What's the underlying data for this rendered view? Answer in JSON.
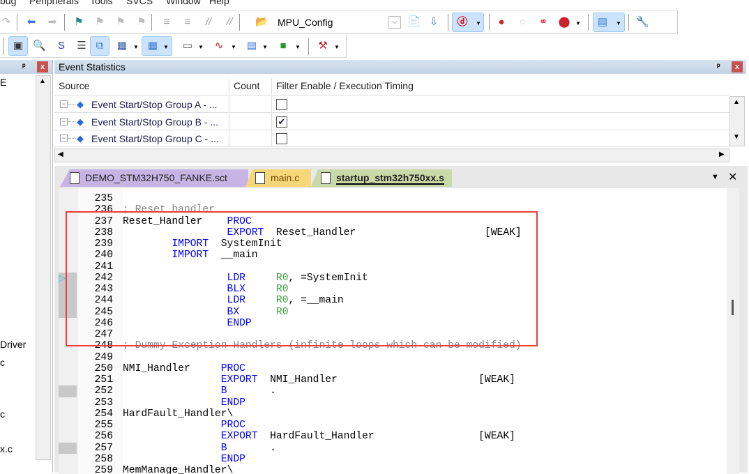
{
  "menu": [
    "bug",
    "Peripherals",
    "Tools",
    "SVCS",
    "Window",
    "Help"
  ],
  "toolbar": {
    "target_name": "MPU_Config"
  },
  "left_panel": {
    "items": [
      "E",
      "Driver",
      "c",
      "c",
      "x.c"
    ]
  },
  "event_statistics": {
    "title": "Event Statistics",
    "columns": [
      "Source",
      "Count",
      "Filter Enable / Execution Timing"
    ],
    "rows": [
      {
        "source": "Event Start/Stop Group A - ...",
        "count": "",
        "enabled": false
      },
      {
        "source": "Event Start/Stop Group B - ...",
        "count": "",
        "enabled": true
      },
      {
        "source": "Event Start/Stop Group C - ...",
        "count": "",
        "enabled": false
      }
    ]
  },
  "editor": {
    "tabs": [
      {
        "label": "DEMO_STM32H750_FANKE.sct",
        "color": "#c8b4e4",
        "active": false
      },
      {
        "label": "main.c",
        "color": "#f5d77a",
        "active": false
      },
      {
        "label": "startup_stm32h750xx.s",
        "color": "#c9d9a7",
        "active": true
      }
    ],
    "current_line": 242,
    "lines": [
      {
        "n": "235",
        "s": []
      },
      {
        "n": "236",
        "s": [
          [
            "; Reset handler",
            "c"
          ]
        ]
      },
      {
        "n": "237",
        "s": [
          [
            "Reset_Handler    ",
            "p"
          ],
          [
            "PROC",
            "k"
          ]
        ]
      },
      {
        "n": "238",
        "s": [
          [
            "                 ",
            "p"
          ],
          [
            "EXPORT",
            "k"
          ],
          [
            "  Reset_Handler                     [WEAK]",
            "p"
          ]
        ]
      },
      {
        "n": "239",
        "s": [
          [
            "        ",
            "p"
          ],
          [
            "IMPORT",
            "k"
          ],
          [
            "  SystemInit",
            "p"
          ]
        ]
      },
      {
        "n": "240",
        "s": [
          [
            "        ",
            "p"
          ],
          [
            "IMPORT",
            "k"
          ],
          [
            "  __main",
            "p"
          ]
        ]
      },
      {
        "n": "241",
        "s": []
      },
      {
        "n": "242",
        "s": [
          [
            "                 ",
            "p"
          ],
          [
            "LDR",
            "k"
          ],
          [
            "     ",
            "p"
          ],
          [
            "R0",
            "r"
          ],
          [
            ", =SystemInit",
            "p"
          ]
        ]
      },
      {
        "n": "243",
        "s": [
          [
            "                 ",
            "p"
          ],
          [
            "BLX",
            "k"
          ],
          [
            "     ",
            "p"
          ],
          [
            "R0",
            "r"
          ]
        ]
      },
      {
        "n": "244",
        "s": [
          [
            "                 ",
            "p"
          ],
          [
            "LDR",
            "k"
          ],
          [
            "     ",
            "p"
          ],
          [
            "R0",
            "r"
          ],
          [
            ", =__main",
            "p"
          ]
        ]
      },
      {
        "n": "245",
        "s": [
          [
            "                 ",
            "p"
          ],
          [
            "BX",
            "k"
          ],
          [
            "      ",
            "p"
          ],
          [
            "R0",
            "r"
          ]
        ]
      },
      {
        "n": "246",
        "s": [
          [
            "                 ",
            "p"
          ],
          [
            "ENDP",
            "k"
          ]
        ]
      },
      {
        "n": "247",
        "s": []
      },
      {
        "n": "248",
        "s": [
          [
            "; Dummy Exception Handlers (infinite loops which can be modified)",
            "c"
          ]
        ]
      },
      {
        "n": "249",
        "s": []
      },
      {
        "n": "250",
        "s": [
          [
            "NMI_Handler     ",
            "p"
          ],
          [
            "PROC",
            "k"
          ]
        ]
      },
      {
        "n": "251",
        "s": [
          [
            "                ",
            "p"
          ],
          [
            "EXPORT",
            "k"
          ],
          [
            "  NMI_Handler                       [WEAK]",
            "p"
          ]
        ]
      },
      {
        "n": "252",
        "s": [
          [
            "                ",
            "p"
          ],
          [
            "B",
            "k"
          ],
          [
            "       .",
            "p"
          ]
        ]
      },
      {
        "n": "253",
        "s": [
          [
            "                ",
            "p"
          ],
          [
            "ENDP",
            "k"
          ]
        ]
      },
      {
        "n": "254",
        "s": [
          [
            "HardFault_Handler\\",
            "p"
          ]
        ]
      },
      {
        "n": "255",
        "s": [
          [
            "                ",
            "p"
          ],
          [
            "PROC",
            "k"
          ]
        ]
      },
      {
        "n": "256",
        "s": [
          [
            "                ",
            "p"
          ],
          [
            "EXPORT",
            "k"
          ],
          [
            "  HardFault_Handler                 [WEAK]",
            "p"
          ]
        ]
      },
      {
        "n": "257",
        "s": [
          [
            "                ",
            "p"
          ],
          [
            "B",
            "k"
          ],
          [
            "       .",
            "p"
          ]
        ]
      },
      {
        "n": "258",
        "s": [
          [
            "                ",
            "p"
          ],
          [
            "ENDP",
            "k"
          ]
        ]
      },
      {
        "n": "259",
        "s": [
          [
            "MemManage_Handler\\",
            "p"
          ]
        ]
      }
    ],
    "marked_lines": [
      242,
      243,
      244,
      245,
      252,
      257
    ]
  },
  "colors": {
    "keyword": "#0000ff",
    "register": "#3fa33f",
    "comment": "#888888",
    "highlight_box": "#f03c3c"
  }
}
